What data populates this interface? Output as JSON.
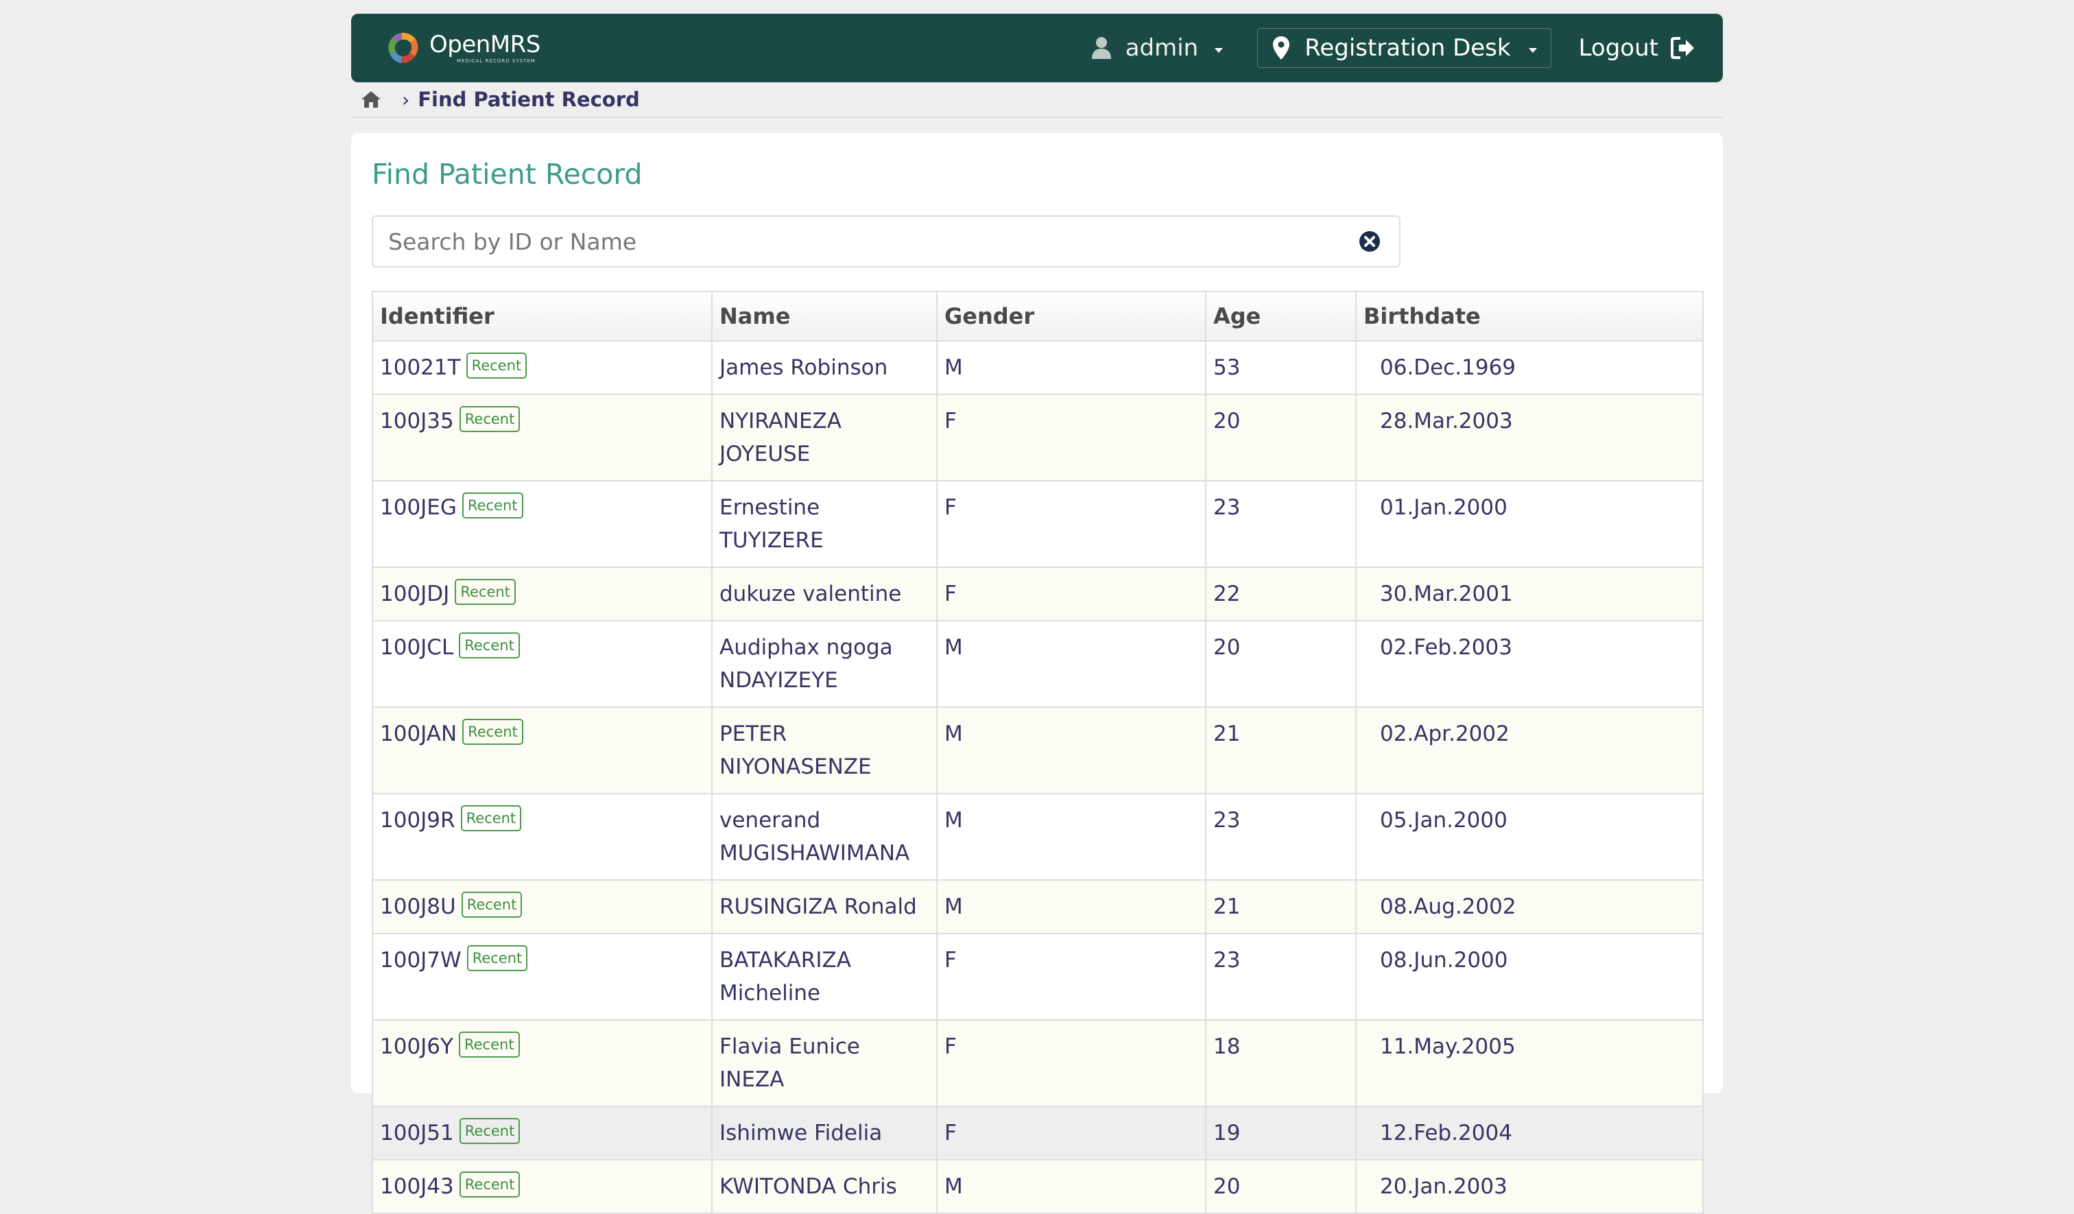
{
  "header": {
    "logo_name": "OpenMRS",
    "logo_sub": "MEDICAL RECORD SYSTEM",
    "user": "admin",
    "location": "Registration Desk",
    "logout_label": "Logout",
    "icons": {
      "user": "user-icon",
      "location": "map-marker-icon",
      "logout": "sign-out-icon",
      "home": "home-icon"
    },
    "brand_color": "#1a4a43"
  },
  "breadcrumb": {
    "current": "Find Patient Record"
  },
  "main": {
    "title": "Find Patient Record",
    "search": {
      "placeholder": "Search by ID or Name",
      "value": ""
    },
    "table": {
      "columns": [
        "Identifier",
        "Name",
        "Gender",
        "Age",
        "Birthdate"
      ],
      "badge_label": "Recent",
      "rows": [
        {
          "id": "10021T",
          "name": "James Robinson",
          "gender": "M",
          "age": "53",
          "birthdate": "06.Dec.1969"
        },
        {
          "id": "100J35",
          "name": "NYIRANEZA JOYEUSE",
          "gender": "F",
          "age": "20",
          "birthdate": "28.Mar.2003"
        },
        {
          "id": "100JEG",
          "name": "Ernestine TUYIZERE",
          "gender": "F",
          "age": "23",
          "birthdate": "01.Jan.2000"
        },
        {
          "id": "100JDJ",
          "name": "dukuze valentine",
          "gender": "F",
          "age": "22",
          "birthdate": "30.Mar.2001"
        },
        {
          "id": "100JCL",
          "name": "Audiphax ngoga NDAYIZEYE",
          "gender": "M",
          "age": "20",
          "birthdate": "02.Feb.2003"
        },
        {
          "id": "100JAN",
          "name": "PETER NIYONASENZE",
          "gender": "M",
          "age": "21",
          "birthdate": "02.Apr.2002"
        },
        {
          "id": "100J9R",
          "name": "venerand MUGISHAWIMANA",
          "gender": "M",
          "age": "23",
          "birthdate": "05.Jan.2000"
        },
        {
          "id": "100J8U",
          "name": "RUSINGIZA Ronald",
          "gender": "M",
          "age": "21",
          "birthdate": "08.Aug.2002"
        },
        {
          "id": "100J7W",
          "name": "BATAKARIZA Micheline",
          "gender": "F",
          "age": "23",
          "birthdate": "08.Jun.2000"
        },
        {
          "id": "100J6Y",
          "name": "Flavia Eunice INEZA",
          "gender": "F",
          "age": "18",
          "birthdate": "11.May.2005"
        },
        {
          "id": "100J51",
          "name": "Ishimwe Fidelia",
          "gender": "F",
          "age": "19",
          "birthdate": "12.Feb.2004"
        },
        {
          "id": "100J43",
          "name": "KWITONDA Chris",
          "gender": "M",
          "age": "20",
          "birthdate": "20.Jan.2003"
        }
      ]
    }
  },
  "colors": {
    "title": "#3a9c8a",
    "badge": "#3d8f3d",
    "text": "#363463"
  }
}
